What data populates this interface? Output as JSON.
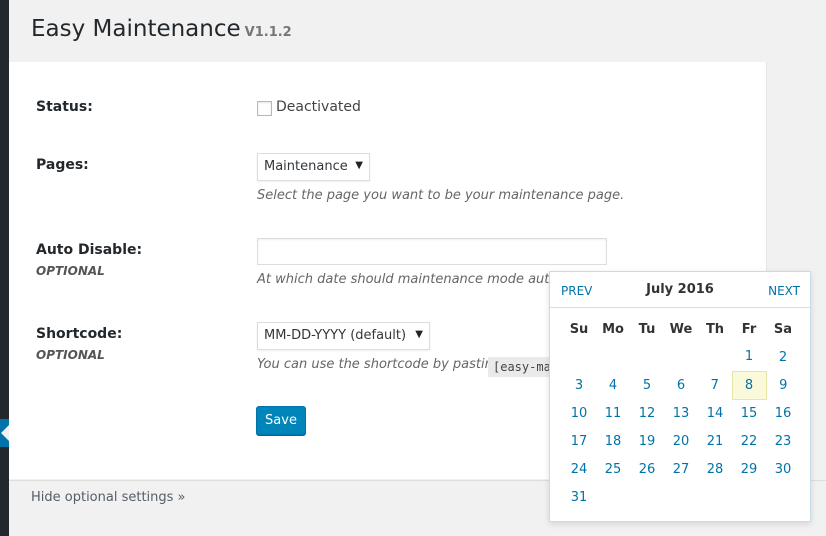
{
  "header": {
    "title": "Easy Maintenance",
    "version": "V1.1.2"
  },
  "status": {
    "label": "Status:",
    "checkbox_label": "Deactivated"
  },
  "pages": {
    "label": "Pages:",
    "selected": "Maintenance",
    "description": "Select the page you want to be your maintenance page."
  },
  "auto_disable": {
    "label": "Auto Disable:",
    "optional": "OPTIONAL",
    "value": "",
    "description": "At which date should maintenance mode autom"
  },
  "shortcode": {
    "label": "Shortcode:",
    "optional": "OPTIONAL",
    "selected": "MM-DD-YYYY (default)",
    "description": "You can use the shortcode by pasting",
    "code": "[easy-ma"
  },
  "save_label": "Save",
  "footer": {
    "hide_link": "Hide optional settings »"
  },
  "datepicker": {
    "prev": "PREV",
    "next": "NEXT",
    "month_title": "July 2016",
    "weekdays": [
      "Su",
      "Mo",
      "Tu",
      "We",
      "Th",
      "Fr",
      "Sa"
    ],
    "weeks": [
      [
        "",
        "",
        "",
        "",
        "",
        "1",
        "2"
      ],
      [
        "3",
        "4",
        "5",
        "6",
        "7",
        "8",
        "9"
      ],
      [
        "10",
        "11",
        "12",
        "13",
        "14",
        "15",
        "16"
      ],
      [
        "17",
        "18",
        "19",
        "20",
        "21",
        "22",
        "23"
      ],
      [
        "24",
        "25",
        "26",
        "27",
        "28",
        "29",
        "30"
      ],
      [
        "31",
        "",
        "",
        "",
        "",
        "",
        ""
      ]
    ],
    "highlighted_day": "8"
  }
}
